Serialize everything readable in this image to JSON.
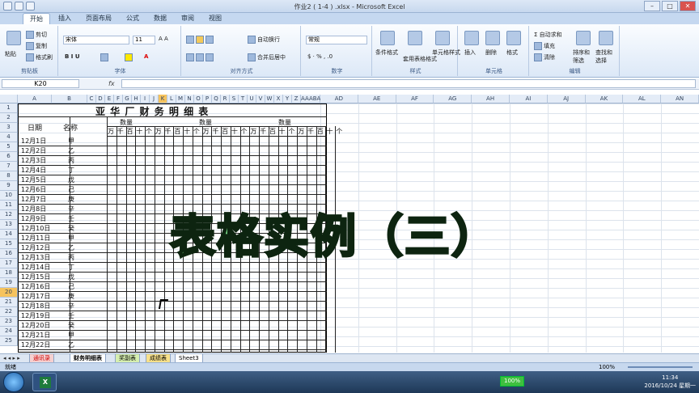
{
  "window": {
    "title": "作业2 ( 1-4 ) .xlsx - Microsoft Excel"
  },
  "ribbon": {
    "tabs": [
      "开始",
      "插入",
      "页面布局",
      "公式",
      "数据",
      "审阅",
      "视图"
    ],
    "clipboard": {
      "paste": "粘贴",
      "cut": "剪切",
      "copy": "复制",
      "format_painter": "格式刷",
      "label": "剪贴板"
    },
    "font": {
      "name": "宋体",
      "size": "11",
      "label": "字体"
    },
    "alignment": {
      "wrap": "自动换行",
      "merge": "合并后居中",
      "label": "对齐方式"
    },
    "number": {
      "format": "常规",
      "label": "数字"
    },
    "styles": {
      "conditional": "条件格式",
      "table": "套用表格格式",
      "cell": "单元格样式",
      "label": "样式"
    },
    "cells": {
      "insert": "插入",
      "delete": "删除",
      "format": "格式",
      "label": "单元格"
    },
    "editing": {
      "autosum": "自动求和",
      "fill": "填充",
      "clear": "清除",
      "sort": "排序和筛选",
      "find": "查找和选择",
      "label": "编辑"
    }
  },
  "formula_bar": {
    "name_box": "K20",
    "fx": "fx",
    "value": ""
  },
  "columns": {
    "left": [
      "A",
      "B",
      "C",
      "D",
      "E",
      "F",
      "G",
      "H",
      "I",
      "J",
      "K",
      "L",
      "M",
      "N",
      "O",
      "P",
      "Q",
      "R",
      "S",
      "T",
      "U",
      "V",
      "W",
      "X",
      "Y",
      "Z",
      "AAABAC"
    ],
    "right": [
      "AD",
      "AE",
      "AF",
      "AG",
      "AH",
      "AI",
      "AJ",
      "AK",
      "AL",
      "AN"
    ]
  },
  "rows": [
    "1",
    "2",
    "3",
    "4",
    "5",
    "6",
    "7",
    "8",
    "9",
    "10",
    "11",
    "12",
    "13",
    "14",
    "15",
    "16",
    "17",
    "18",
    "19",
    "20",
    "21",
    "22",
    "23",
    "24",
    "25"
  ],
  "sheet": {
    "title": "亚 华 厂 财 务 明 细 表",
    "date_header": "日期",
    "name_header": "名称",
    "qty_headers": [
      "数量",
      "数量",
      "数量"
    ],
    "digit_headers": [
      "万",
      "千",
      "百",
      "十",
      "个",
      "万",
      "千",
      "百",
      "十",
      "个",
      "万",
      "千",
      "百",
      "十",
      "个",
      "万",
      "千",
      "百",
      "十",
      "个",
      "万",
      "千",
      "百",
      "十",
      "个"
    ],
    "dates": [
      "12月1日",
      "12月2日",
      "12月3日",
      "12月4日",
      "12月5日",
      "12月6日",
      "12月7日",
      "12月8日",
      "12月9日",
      "12月10日",
      "12月11日",
      "12月12日",
      "12月13日",
      "12月14日",
      "12月15日",
      "12月16日",
      "12月17日",
      "12月18日",
      "12月19日",
      "12月20日",
      "12月21日",
      "12月22日"
    ],
    "names": [
      "甲",
      "乙",
      "丙",
      "丁",
      "戊",
      "己",
      "庚",
      "辛",
      "壬",
      "癸",
      "甲",
      "乙",
      "丙",
      "丁",
      "戊",
      "己",
      "庚",
      "辛",
      "壬",
      "癸",
      "甲",
      "乙"
    ]
  },
  "overlay": {
    "title": "表格实例（三）"
  },
  "sheet_tabs": [
    "通讯录",
    "财务明细表",
    "奖副表",
    "成绩表",
    "Sheet3"
  ],
  "status": {
    "left": "就绪",
    "zoom": "100%"
  },
  "taskbar": {
    "battery": "100%",
    "time": "11:34",
    "date": "2016/10/24 星期一"
  }
}
